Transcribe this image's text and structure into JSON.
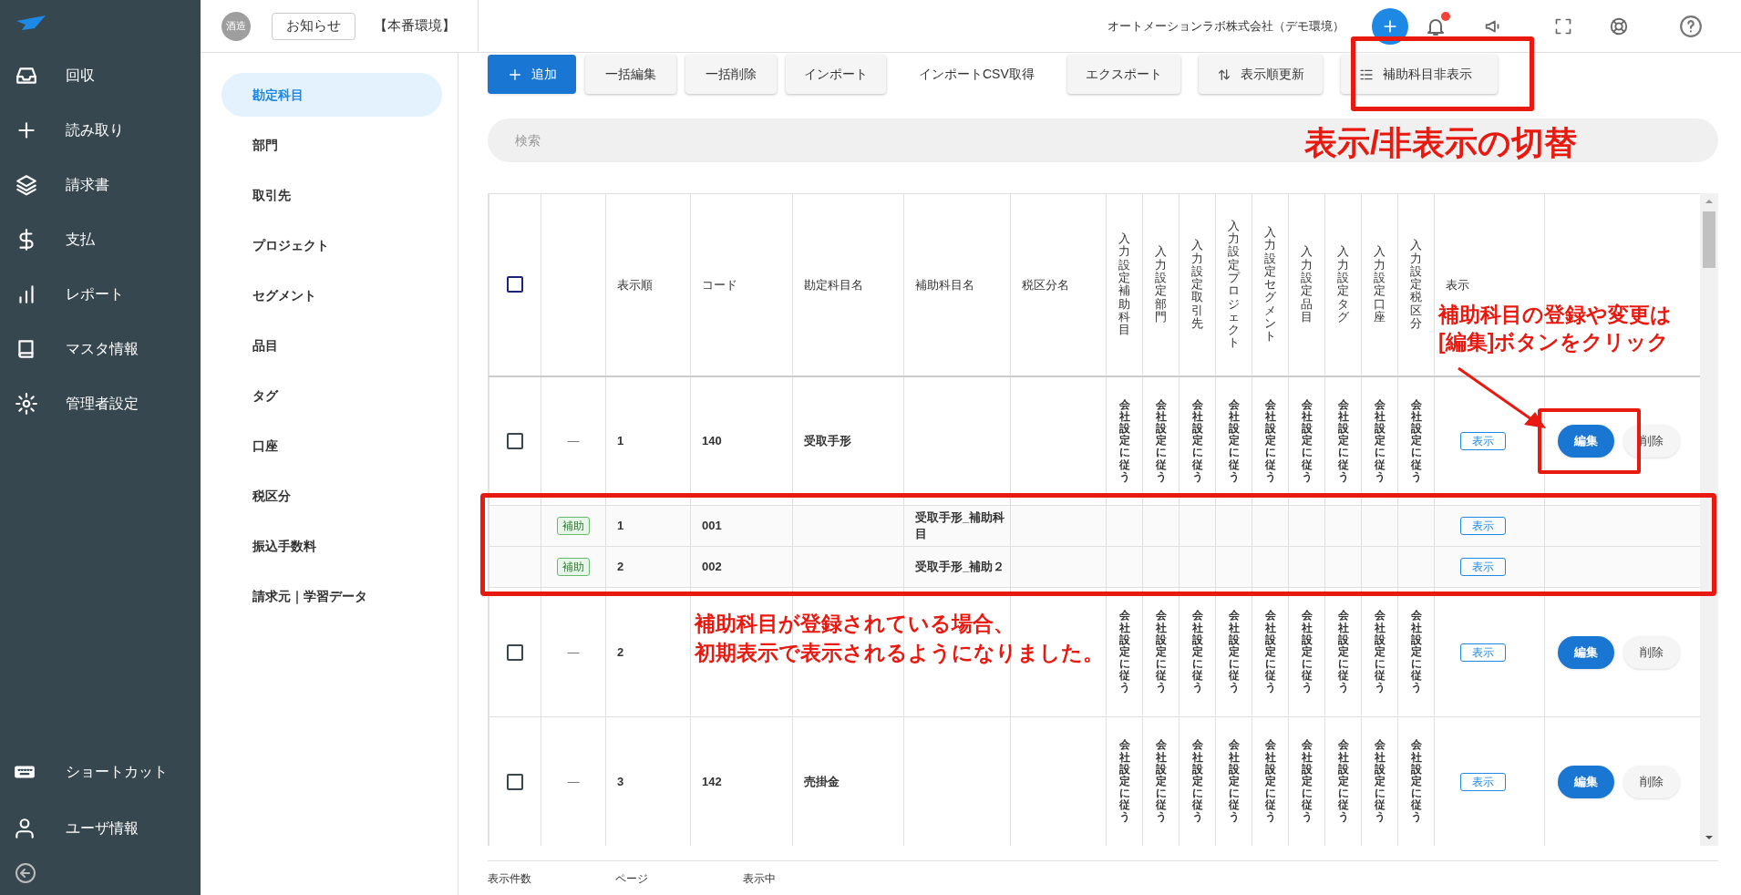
{
  "sidebar": {
    "top_items": [
      "回収",
      "読み取り",
      "請求書",
      "支払",
      "レポート",
      "マスタ情報",
      "管理者設定"
    ],
    "bottom_items": [
      "ショートカット",
      "ユーザ情報"
    ]
  },
  "header": {
    "avatar": "酒造",
    "notice_button": "お知らせ",
    "environment": "【本番環境】",
    "company": "オートメーションラボ株式会社（デモ環境）",
    "unread": true
  },
  "subnav": {
    "items": [
      {
        "label": "勘定科目",
        "selected": true
      },
      {
        "label": "部門",
        "selected": false
      },
      {
        "label": "取引先",
        "selected": false
      },
      {
        "label": "プロジェクト",
        "selected": false
      },
      {
        "label": "セグメント",
        "selected": false
      },
      {
        "label": "品目",
        "selected": false
      },
      {
        "label": "タグ",
        "selected": false
      },
      {
        "label": "口座",
        "selected": false
      },
      {
        "label": "税区分",
        "selected": false
      },
      {
        "label": "振込手数料",
        "selected": false
      },
      {
        "label": "請求元｜学習データ",
        "selected": false
      }
    ]
  },
  "toolbar": {
    "buttons": [
      {
        "label": "追加",
        "kind": "add"
      },
      {
        "label": "一括編集",
        "kind": "plain"
      },
      {
        "label": "一括削除",
        "kind": "plain"
      },
      {
        "label": "インポート",
        "kind": "plain"
      },
      {
        "label": "インポートCSV取得",
        "kind": "text"
      },
      {
        "label": "エクスポート",
        "kind": "plain"
      },
      {
        "label": "表示順更新",
        "kind": "sort"
      },
      {
        "label": "補助科目非表示",
        "kind": "list"
      }
    ]
  },
  "search": {
    "placeholder": "検索"
  },
  "table": {
    "header_checked": false,
    "columns": [
      "表示順",
      "コード",
      "勘定科目名",
      "補助科目名",
      "税区分名"
    ],
    "setting_columns": [
      "入力設定補助科目",
      "入力設定部門",
      "入力設定取引先",
      "入力設定プロジェクト",
      "入力設定セグメント",
      "入力設定品目",
      "入力設定タグ",
      "入力設定口座",
      "入力設定税区分"
    ],
    "display_column": "表示",
    "rows": [
      {
        "kind": "account",
        "checked": false,
        "mark": "—",
        "order": "1",
        "code": "140",
        "name": "受取手形",
        "settings": [
          "会社設定に従う",
          "会社設定に従う",
          "会社設定に従う",
          "会社設定に従う",
          "会社設定に従う",
          "会社設定に従う",
          "会社設定に従う",
          "会社設定に従う",
          "会社設定に従う"
        ],
        "display": "表示",
        "edit": "編集",
        "delete": "削除"
      },
      {
        "kind": "sub",
        "tag": "補助",
        "order": "1",
        "code": "001",
        "sub_name": "受取手形_補助科目",
        "display": "表示"
      },
      {
        "kind": "sub",
        "tag": "補助",
        "order": "2",
        "code": "002",
        "sub_name": "受取手形_補助２",
        "display": "表示"
      },
      {
        "kind": "account",
        "checked": false,
        "mark": "—",
        "order": "2",
        "settings": [
          "会社設定に従う",
          "会社設定に従う",
          "会社設定に従う",
          "会社設定に従う",
          "会社設定に従う",
          "会社設定に従う",
          "会社設定に従う",
          "会社設定に従う",
          "会社設定に従う"
        ],
        "display": "表示",
        "edit": "編集",
        "delete": "削除"
      },
      {
        "kind": "account",
        "checked": false,
        "mark": "—",
        "order": "3",
        "code": "142",
        "name": "売掛金",
        "settings": [
          "会社設定に従う",
          "会社設定に従う",
          "会社設定に従う",
          "会社設定に従う",
          "会社設定に従う",
          "会社設定に従う",
          "会社設定に従う",
          "会社設定に従う",
          "会社設定に従う"
        ],
        "display": "表示",
        "edit": "編集",
        "delete": "削除"
      }
    ]
  },
  "footer": {
    "labels": [
      "表示件数",
      "ページ",
      "表示中"
    ]
  },
  "annotations": {
    "toggle_note": "表示/非表示の切替",
    "edit_note": [
      "補助科目の登録や変更は",
      "[編集]ボタンをクリック"
    ],
    "sub_note": [
      "補助科目が登録されている場合、",
      "初期表示で表示されるようになりました。"
    ]
  }
}
